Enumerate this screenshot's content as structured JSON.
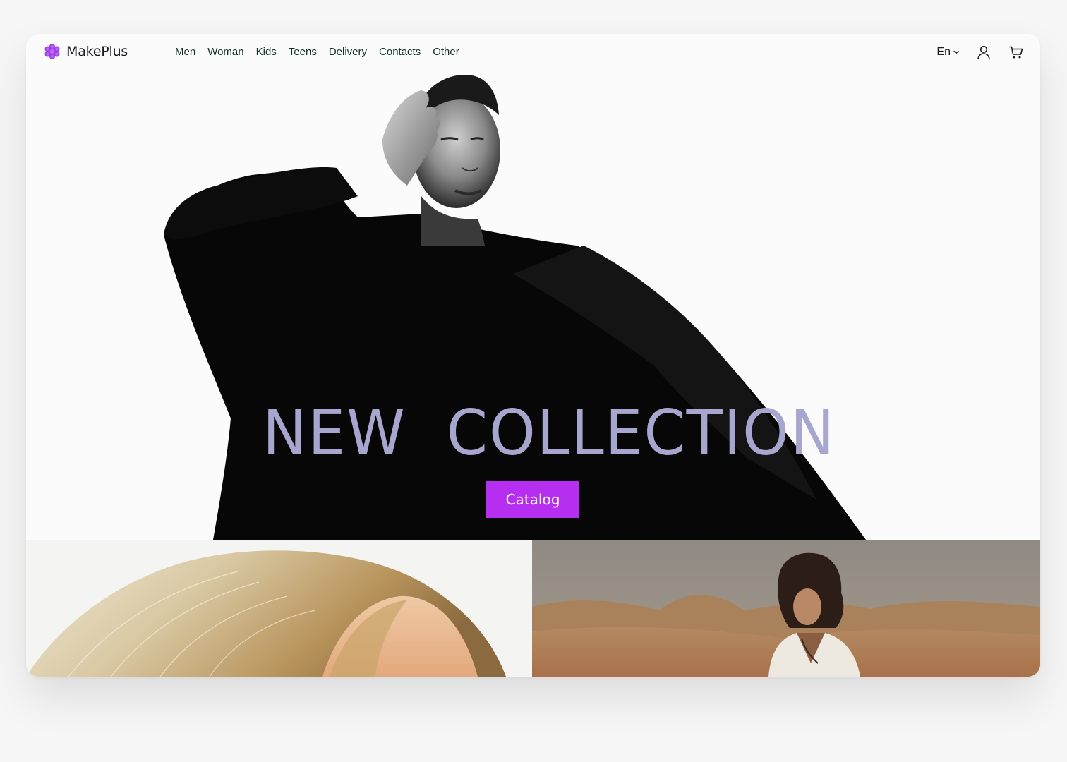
{
  "brand": {
    "name": "MakePlus",
    "accent_color": "#b62ff0"
  },
  "nav": {
    "items": [
      {
        "label": "Men"
      },
      {
        "label": "Woman"
      },
      {
        "label": "Kids"
      },
      {
        "label": "Teens"
      },
      {
        "label": "Delivery"
      },
      {
        "label": "Contacts"
      },
      {
        "label": "Other"
      }
    ]
  },
  "header": {
    "language": "En",
    "account_icon": "user-icon",
    "cart_icon": "cart-icon"
  },
  "hero": {
    "title": "NEW  COLLECTION",
    "title_color": "#a6a6ce",
    "cta_label": "Catalog",
    "image": "black-and-white-model-in-black-coat"
  },
  "tiles": [
    {
      "image": "blonde-hair-closeup"
    },
    {
      "image": "model-in-desert-white-jacket"
    }
  ]
}
